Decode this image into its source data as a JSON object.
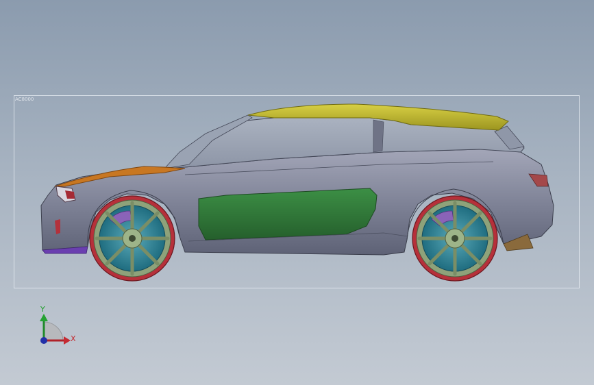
{
  "viewport": {
    "bounding_box_label": "AC8000"
  },
  "triad": {
    "y_label": "Y",
    "x_label": "X"
  },
  "colors": {
    "roof": "#b9b12a",
    "hood": "#c87722",
    "door_panel": "#2e7a38",
    "body": "#6f7386",
    "tire": "#b6303a",
    "rim": "#8ea27a",
    "brake_disc": "#2f8ea0",
    "caliper": "#8a63b8",
    "rear_diffuser": "#8a6a3c",
    "front_splitter": "#6a3fb0"
  },
  "model": {
    "name_icon": "car-model-side-view"
  }
}
